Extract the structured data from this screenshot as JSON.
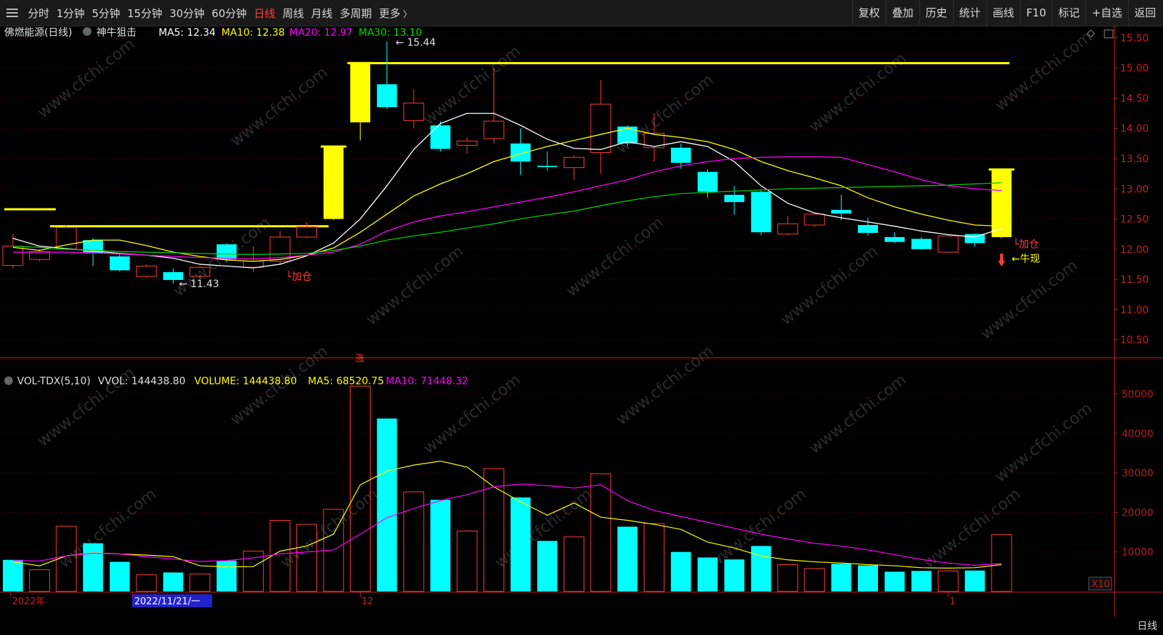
{
  "toolbar": {
    "periods": [
      "分时",
      "1分钟",
      "5分钟",
      "15分钟",
      "30分钟",
      "60分钟",
      "日线",
      "周线",
      "月线",
      "多周期",
      "更多"
    ],
    "active_period": "日线",
    "right_buttons": [
      "复权",
      "叠加",
      "历史",
      "统计",
      "画线",
      "F10",
      "标记",
      "+自选",
      "返回"
    ]
  },
  "watermark": "www.cfchi.com",
  "colors": {
    "background": "#000000",
    "up": "#ff3b3b",
    "down": "#00ffff",
    "ma5": "#ffffff",
    "ma10": "#ffff00",
    "ma20": "#ff00ff",
    "ma30": "#00cc00",
    "axis": "#c81e1e",
    "volume_axis": "#b41e1e"
  },
  "main_header": {
    "title": "佛燃能源(日线)",
    "indicator": "神牛狙击",
    "ma5": "MA5: 12.34",
    "ma10": "MA10: 12.38",
    "ma20": "MA20: 12.97",
    "ma30": "MA30: 13.10"
  },
  "vol_header": {
    "name": "VOL-TDX(5,10)",
    "vvol": "VVOL: 144438.80",
    "volume": "VOLUME: 144438.80",
    "ma5": "MA5: 68520.75",
    "ma10": "MA10: 71448.32"
  },
  "chart_data": [
    {
      "type": "candlestick",
      "title": "佛燃能源(日线)",
      "y_ticks": [
        10.5,
        11.0,
        11.5,
        12.0,
        12.5,
        13.0,
        13.5,
        14.0,
        14.5,
        15.0,
        15.5
      ],
      "ylim": [
        10.2,
        15.7
      ],
      "candles": [
        {
          "o": 11.73,
          "h": 12.25,
          "l": 11.68,
          "c": 12.05
        },
        {
          "o": 11.83,
          "h": 12.0,
          "l": 11.8,
          "c": 11.96
        },
        {
          "o": 12.0,
          "h": 12.4,
          "l": 11.98,
          "c": 12.36
        },
        {
          "o": 12.15,
          "h": 12.18,
          "l": 11.72,
          "c": 11.93
        },
        {
          "o": 11.88,
          "h": 11.92,
          "l": 11.63,
          "c": 11.65
        },
        {
          "o": 11.55,
          "h": 11.75,
          "l": 11.52,
          "c": 11.72
        },
        {
          "o": 11.62,
          "h": 11.68,
          "l": 11.43,
          "c": 11.49
        },
        {
          "o": 11.55,
          "h": 11.72,
          "l": 11.52,
          "c": 11.7
        },
        {
          "o": 12.08,
          "h": 12.1,
          "l": 11.78,
          "c": 11.83
        },
        {
          "o": 11.7,
          "h": 12.05,
          "l": 11.62,
          "c": 11.8
        },
        {
          "o": 11.8,
          "h": 12.3,
          "l": 11.75,
          "c": 12.2
        },
        {
          "o": 12.2,
          "h": 12.45,
          "l": 12.18,
          "c": 12.37
        },
        {
          "o": 12.5,
          "h": 13.72,
          "l": 12.48,
          "c": 13.7
        },
        {
          "o": 14.1,
          "h": 15.1,
          "l": 13.8,
          "c": 15.08
        },
        {
          "o": 14.73,
          "h": 15.44,
          "l": 14.32,
          "c": 14.35
        },
        {
          "o": 14.13,
          "h": 14.65,
          "l": 14.0,
          "c": 14.42
        },
        {
          "o": 14.05,
          "h": 14.12,
          "l": 13.62,
          "c": 13.66
        },
        {
          "o": 13.72,
          "h": 13.85,
          "l": 13.58,
          "c": 13.79
        },
        {
          "o": 13.83,
          "h": 15.0,
          "l": 13.75,
          "c": 14.12
        },
        {
          "o": 13.75,
          "h": 14.0,
          "l": 13.23,
          "c": 13.45
        },
        {
          "o": 13.38,
          "h": 13.62,
          "l": 13.3,
          "c": 13.36
        },
        {
          "o": 13.35,
          "h": 13.55,
          "l": 13.15,
          "c": 13.52
        },
        {
          "o": 13.6,
          "h": 14.8,
          "l": 13.25,
          "c": 14.4
        },
        {
          "o": 14.03,
          "h": 14.05,
          "l": 13.72,
          "c": 13.75
        },
        {
          "o": 13.68,
          "h": 14.25,
          "l": 13.45,
          "c": 13.92
        },
        {
          "o": 13.68,
          "h": 13.75,
          "l": 13.33,
          "c": 13.43
        },
        {
          "o": 13.28,
          "h": 13.32,
          "l": 12.85,
          "c": 12.95
        },
        {
          "o": 12.9,
          "h": 13.05,
          "l": 12.57,
          "c": 12.78
        },
        {
          "o": 12.95,
          "h": 12.97,
          "l": 12.23,
          "c": 12.28
        },
        {
          "o": 12.25,
          "h": 12.55,
          "l": 12.23,
          "c": 12.42
        },
        {
          "o": 12.4,
          "h": 12.58,
          "l": 12.37,
          "c": 12.58
        },
        {
          "o": 12.65,
          "h": 12.9,
          "l": 12.48,
          "c": 12.59
        },
        {
          "o": 12.4,
          "h": 12.52,
          "l": 12.22,
          "c": 12.27
        },
        {
          "o": 12.2,
          "h": 12.28,
          "l": 12.1,
          "c": 12.12
        },
        {
          "o": 12.17,
          "h": 12.2,
          "l": 11.99,
          "c": 12.0
        },
        {
          "o": 11.95,
          "h": 12.25,
          "l": 11.94,
          "c": 12.22
        },
        {
          "o": 12.25,
          "h": 12.26,
          "l": 12.04,
          "c": 12.1
        },
        {
          "o": 12.2,
          "h": 13.33,
          "l": 12.18,
          "c": 13.32
        }
      ],
      "ma_lines": {
        "MA5": [
          12.18,
          12.05,
          12.01,
          11.97,
          11.93,
          11.9,
          11.85,
          11.75,
          11.72,
          11.69,
          11.75,
          11.89,
          12.1,
          12.5,
          13.05,
          13.65,
          14.08,
          14.25,
          14.25,
          14.05,
          13.82,
          13.67,
          13.65,
          13.78,
          13.7,
          13.78,
          13.7,
          13.45,
          13.05,
          12.76,
          12.6,
          12.52,
          12.45,
          12.38,
          12.3,
          12.24,
          12.2,
          12.34
        ],
        "MA10": [
          12.03,
          11.98,
          12.07,
          12.15,
          12.15,
          12.06,
          11.95,
          11.88,
          11.82,
          11.8,
          11.83,
          11.9,
          12.02,
          12.28,
          12.58,
          12.88,
          13.08,
          13.25,
          13.45,
          13.58,
          13.7,
          13.8,
          13.9,
          14.0,
          13.9,
          13.85,
          13.78,
          13.65,
          13.45,
          13.3,
          13.18,
          13.05,
          12.85,
          12.7,
          12.58,
          12.48,
          12.4,
          12.38
        ],
        "MA20": [
          11.95,
          11.95,
          11.95,
          11.94,
          11.92,
          11.9,
          11.88,
          11.86,
          11.85,
          11.84,
          11.86,
          11.9,
          11.95,
          12.08,
          12.3,
          12.45,
          12.55,
          12.62,
          12.7,
          12.78,
          12.86,
          12.95,
          13.05,
          13.15,
          13.28,
          13.38,
          13.45,
          13.5,
          13.52,
          13.53,
          13.53,
          13.52,
          13.4,
          13.28,
          13.15,
          13.05,
          13.0,
          12.97
        ],
        "MA30": [
          12.05,
          12.03,
          12.0,
          11.98,
          11.96,
          11.95,
          11.94,
          11.93,
          11.92,
          11.91,
          11.92,
          11.93,
          11.98,
          12.05,
          12.15,
          12.22,
          12.28,
          12.35,
          12.42,
          12.5,
          12.57,
          12.63,
          12.72,
          12.8,
          12.87,
          12.92,
          12.94,
          12.96,
          12.98,
          13.0,
          13.01,
          13.02,
          13.03,
          13.04,
          13.05,
          13.06,
          13.08,
          13.1
        ]
      },
      "resistance_line": 15.08,
      "support_line": 12.38,
      "left_marker": 12.66,
      "annotations": [
        {
          "text": "15.44",
          "candle": 14,
          "price": 15.44
        },
        {
          "text": "11.43",
          "candle": 6,
          "price": 11.43
        },
        {
          "text": "加仓",
          "candle": 10,
          "price": 11.75
        },
        {
          "text": "加仓",
          "candle": 37,
          "price": 12.05
        },
        {
          "text": "牛现",
          "candle": 37,
          "price": 11.95
        },
        {
          "text": "涨",
          "candle": 13,
          "price": 10.3
        }
      ]
    },
    {
      "type": "bar",
      "title": "VOL-TDX(5,10)",
      "y_ticks": [
        10000,
        20000,
        30000,
        40000,
        50000
      ],
      "ylim": [
        0,
        55000
      ],
      "y_unit": "X10",
      "volume": [
        8000,
        5500,
        16500,
        12200,
        7500,
        4200,
        4800,
        4400,
        7800,
        10200,
        18000,
        17000,
        20800,
        52000,
        43800,
        25200,
        23200,
        15300,
        31100,
        23800,
        12800,
        13800,
        29800,
        16400,
        17200,
        10000,
        8600,
        8100,
        11500,
        6800,
        5800,
        7000,
        6600,
        5000,
        5200,
        5200,
        5300,
        14400
      ],
      "up_flags": [
        false,
        true,
        true,
        false,
        false,
        true,
        false,
        true,
        false,
        true,
        true,
        true,
        true,
        true,
        false,
        true,
        false,
        true,
        true,
        false,
        false,
        true,
        true,
        false,
        true,
        false,
        false,
        false,
        false,
        true,
        true,
        false,
        false,
        false,
        false,
        true,
        false,
        true
      ],
      "ma5": [
        7500,
        6500,
        9000,
        9800,
        9500,
        9200,
        8800,
        6500,
        6200,
        6300,
        10200,
        11500,
        14500,
        27000,
        30500,
        32000,
        33000,
        31500,
        26500,
        22700,
        19300,
        22400,
        18800,
        18000,
        17000,
        15700,
        12500,
        11000,
        9000,
        8000,
        7500,
        7200,
        6800,
        6500,
        6000,
        5900,
        6000,
        6800
      ],
      "ma10": [
        7800,
        7700,
        9000,
        9700,
        9500,
        8800,
        8200,
        7600,
        7800,
        8500,
        9500,
        10000,
        10500,
        14500,
        18700,
        21000,
        23000,
        24500,
        26500,
        27200,
        26800,
        26200,
        27000,
        23000,
        20500,
        19000,
        17500,
        16000,
        14500,
        13300,
        12200,
        11500,
        10500,
        9300,
        8100,
        7200,
        6600,
        7100
      ]
    }
  ],
  "x_axis": {
    "labels": [
      {
        "text": "2022年",
        "candle": 0
      },
      {
        "text": "2022/11/21/一",
        "candle": 5
      },
      {
        "text": "12",
        "candle": 13
      },
      {
        "text": "1",
        "candle": 35
      }
    ]
  },
  "period_label": "日线"
}
